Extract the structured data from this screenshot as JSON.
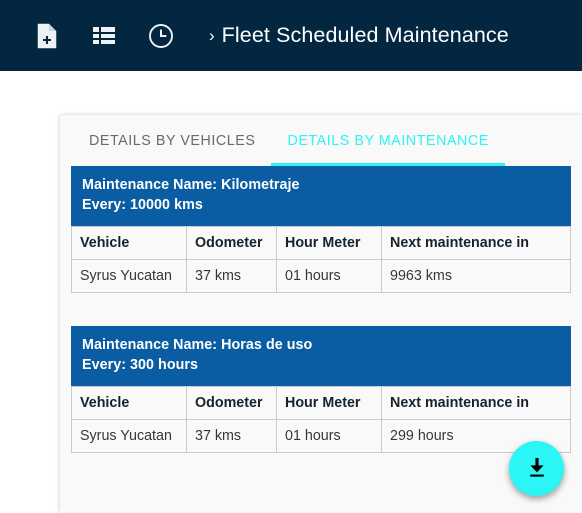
{
  "appbar": {
    "background_color": "#032740",
    "icons": [
      {
        "name": "document-add-icon",
        "label": "New document"
      },
      {
        "name": "table-list-icon",
        "label": "List view"
      },
      {
        "name": "clock-icon",
        "label": "History"
      }
    ],
    "breadcrumb": {
      "separator": "›",
      "title": "Fleet Scheduled Maintenance"
    }
  },
  "tabs": [
    {
      "label": "DETAILS BY VEHICLES",
      "active": false
    },
    {
      "label": "DETAILS BY MAINTENANCE",
      "active": true
    }
  ],
  "accent_color": "#2ff3f3",
  "table_header_color": "#0a5ca3",
  "columns": [
    "Vehicle",
    "Odometer",
    "Hour Meter",
    "Next maintenance in"
  ],
  "maintenance_blocks": [
    {
      "name_line": "Maintenance Name: Kilometraje",
      "every_line": "Every: 10000 kms",
      "rows": [
        {
          "vehicle": "Syrus Yucatan",
          "odometer": "37 kms",
          "hour_meter": "01 hours",
          "next_maintenance_in": "9963 kms"
        }
      ]
    },
    {
      "name_line": "Maintenance Name: Horas de uso",
      "every_line": "Every: 300 hours",
      "rows": [
        {
          "vehicle": "Syrus Yucatan",
          "odometer": "37 kms",
          "hour_meter": "01 hours",
          "next_maintenance_in": "299 hours"
        }
      ]
    }
  ],
  "fab": {
    "name": "download-button",
    "icon": "download-icon",
    "color": "#2bf5f5"
  }
}
